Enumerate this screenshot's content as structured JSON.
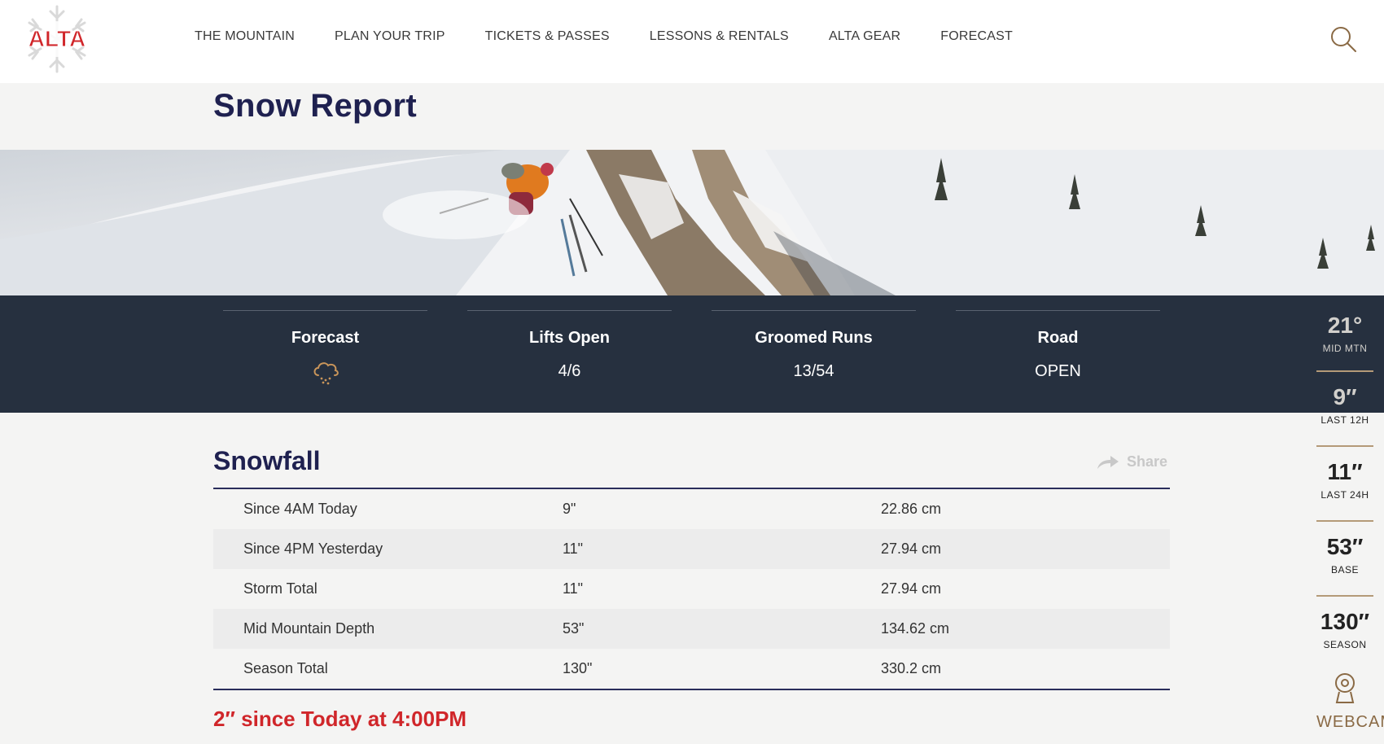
{
  "brand": {
    "logo_text": "ALTA",
    "accent": "#d0262a",
    "navy": "#1f2150"
  },
  "nav": {
    "items": [
      {
        "label": "THE MOUNTAIN"
      },
      {
        "label": "PLAN YOUR TRIP"
      },
      {
        "label": "TICKETS & PASSES"
      },
      {
        "label": "LESSONS & RENTALS"
      },
      {
        "label": "ALTA GEAR"
      },
      {
        "label": "FORECAST"
      }
    ],
    "search_icon": "search-icon"
  },
  "page": {
    "title": "Snow Report"
  },
  "stats": [
    {
      "label": "Forecast",
      "icon": "snow-cloud-icon"
    },
    {
      "label": "Lifts Open",
      "value": "4/6"
    },
    {
      "label": "Groomed Runs",
      "value": "13/54"
    },
    {
      "label": "Road",
      "value": "OPEN"
    }
  ],
  "rail": {
    "items": [
      {
        "value": "21°",
        "label": "MID MTN"
      },
      {
        "value": "9″",
        "label": "LAST 12H"
      },
      {
        "value": "11″",
        "label": "LAST 24H"
      },
      {
        "value": "53″",
        "label": "BASE"
      },
      {
        "value": "130″",
        "label": "SEASON"
      }
    ],
    "webcam_label": "WEBCAM"
  },
  "snowfall": {
    "title": "Snowfall",
    "share_label": "Share",
    "rows": [
      {
        "name": "Since 4AM Today",
        "inches": "9\"",
        "cm": "22.86 cm"
      },
      {
        "name": "Since 4PM Yesterday",
        "inches": "11\"",
        "cm": "27.94 cm"
      },
      {
        "name": "Storm Total",
        "inches": "11\"",
        "cm": "27.94 cm"
      },
      {
        "name": "Mid Mountain Depth",
        "inches": "53\"",
        "cm": "134.62 cm"
      },
      {
        "name": "Season Total",
        "inches": "130\"",
        "cm": "330.2 cm"
      }
    ],
    "notice": "2″ since Today at 4:00PM"
  }
}
